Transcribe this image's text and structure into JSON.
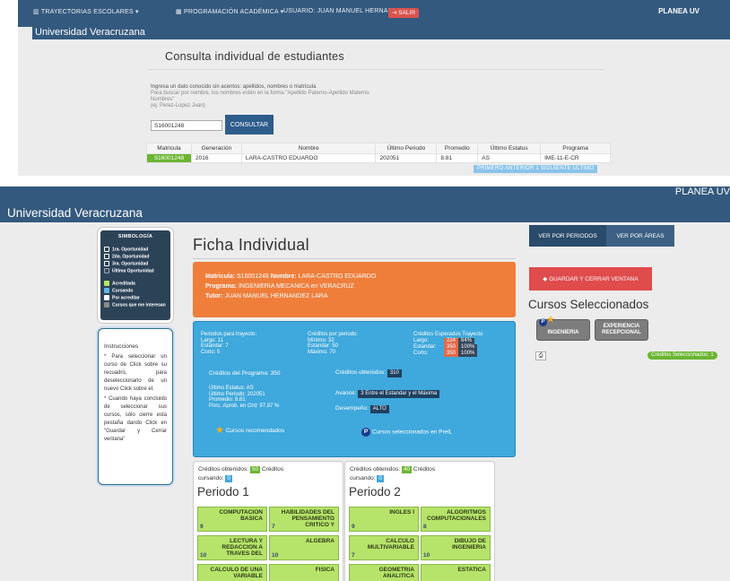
{
  "top": {
    "nav": {
      "trayectorias": "TRAYECTORIAS ESCOLARES",
      "programacion": "PROGRAMACIÓN ACADÉMICA",
      "usuario": "USUARIO: JUAN MANUEL HERNANDEZ",
      "salir": "SALIR",
      "brand": "PLANEA UV"
    },
    "univ": "Universidad Veracruzana",
    "heading": "Consulta individual de estudiantes",
    "help": [
      "Ingresa un dato conocido sin acentos: apellidos, nombres o matrícula",
      "Para buscar por nombre, los nombres estén en la forma \"Apellido Paterno-Apellido Materno Nombres\"",
      "(ej. Perez-Lopez Juan)"
    ],
    "search": {
      "value": "S16001248",
      "button": "CONSULTAR"
    },
    "table": {
      "headers": [
        "Matricula",
        "Generación",
        "Nombre",
        "Último Periodo",
        "Promedio",
        "Último Estatus",
        "Programa"
      ],
      "row": [
        "S16001248",
        "2016",
        "LARA-CASTRO EDUARDO",
        "202051",
        "8.81",
        "AS",
        "IME-11-E-CR"
      ]
    },
    "pager": "PRIMERO  ANTERIOR  1  SIGUIENTE  ÚLTIMO"
  },
  "bottom": {
    "brand": "PLANEA UV",
    "univ": "Universidad Veracruzana",
    "legend": {
      "title": "SIMBOLOGÍA",
      "items": [
        {
          "label": "1ra. Oportunidad",
          "color": "#2c4257",
          "border": "#ffffff"
        },
        {
          "label": "2da. Oportunidad",
          "color": "#2c4257",
          "border": "#ffffff"
        },
        {
          "label": "3ra. Oportunidad",
          "color": "#2c4257",
          "border": "#ffffff"
        },
        {
          "label": "Última Oportunidad",
          "color": "#3a4a5a",
          "border": "#9aa7b4"
        },
        {
          "label": "Acreditada",
          "color": "#b6e36a",
          "border": "#b6e36a"
        },
        {
          "label": "Cursando",
          "color": "#5db6e6",
          "border": "#5db6e6"
        },
        {
          "label": "Por acreditar",
          "color": "#ffffff",
          "border": "#ffffff"
        },
        {
          "label": "Cursos que me interesan",
          "color": "#8a8a8a",
          "border": "#8a8a8a"
        }
      ]
    },
    "instructions": {
      "title": "Instrucciones",
      "p1": "* Para seleccionar un curso de Click sobre su recuadro, para deseleccionarlo de un nuevo Click sobre el.",
      "p2": "* Cuando haya concluido de seleccionar sus cursos, sólo cierre esta pestaña dando Click en \"Guardar y Cerrar ventana\""
    },
    "ficha": {
      "title": "Ficha Individual",
      "matricula_label": "Matricula:",
      "matricula": "S16001248",
      "nombre_label": "Nombre:",
      "nombre": "LARA-CASTRO EDUARDO",
      "programa_label": "Programa:",
      "programa": "INGENIERIA MECANICA en VERACRUZ",
      "tutor_label": "Tutor:",
      "tutor": "JUAN MANUEL HERNANDEZ LARA"
    },
    "summary": {
      "col1": [
        "Periodos para trayecto:",
        "Largo:     11",
        "Estandar:  7",
        "Corto:      5"
      ],
      "col2": [
        "Créditos por periodo:",
        "Mínimo:   32",
        "Estandar: 50",
        "Máximo:   70"
      ],
      "col3_title": "Créditos Esperados Trayecto",
      "col3": [
        {
          "label": "Largo:",
          "value": "224",
          "pct": "64%"
        },
        {
          "label": "Estandar:",
          "value": "350",
          "pct": "100%"
        },
        {
          "label": "Corto:",
          "value": "350",
          "pct": "100%"
        }
      ],
      "programa_creditos": "Créditos del Programa: 350",
      "obtenidos_label": "Créditos obtenidos:",
      "obtenidos": "310",
      "estatus": [
        "Último Estatus: AS",
        "Último Periodo: 202051",
        "Promedio: 8.81",
        "Porc. Aprob. en Ord: 97.87 %"
      ],
      "avance_label": "Avance:",
      "avance": "3 Entre el Estandar y el Máxima",
      "desempeno_label": "Desempeño:",
      "desempeno": "ALTO",
      "recomendados": "Cursos recomendados",
      "seleccionados": "Cursos seleccionados en PrelL"
    },
    "periods": [
      {
        "name": "Periodo 1",
        "cred_label": "Créditos obtenidos:",
        "cred": "50",
        "cred_label2": "Créditos",
        "cursando_label": "cursando:",
        "cursando": "0",
        "courses": [
          {
            "name": "COMPUTACION BASICA",
            "cr": "9"
          },
          {
            "name": "HABILIDADES DEL PENSAMIENTO CRITICO Y",
            "cr": "7"
          },
          {
            "name": "LECTURA Y REDACCION A TRAVES DEL",
            "cr": "10"
          },
          {
            "name": "ALGEBRA",
            "cr": "10"
          },
          {
            "name": "CALCULO DE UNA VARIABLE",
            "cr": "10"
          },
          {
            "name": "FISICA",
            "cr": "9"
          }
        ]
      },
      {
        "name": "Periodo 2",
        "cred_label": "Créditos obtenidos:",
        "cred": "40",
        "cred_label2": "Créditos",
        "cursando_label": "cursando:",
        "cursando": "0",
        "courses": [
          {
            "name": "INGLES I",
            "cr": "9"
          },
          {
            "name": "ALGORITMOS COMPUTACIONALES",
            "cr": "8"
          },
          {
            "name": "CALCULO MULTIVARIABLE",
            "cr": "7"
          },
          {
            "name": "DIBUJO DE INGENIERIA",
            "cr": "10"
          },
          {
            "name": "GEOMETRIA ANALITICA",
            "cr": "8"
          },
          {
            "name": "ESTATICA",
            "cr": "6"
          }
        ]
      }
    ],
    "right": {
      "ver_periodos": "VER POR PERIODOS",
      "ver_areas": "VER POR ÁREAS",
      "save": "GUARDAR Y CERRAR VENTANA",
      "cursos_title": "Cursos Seleccionados",
      "tile1": "INGENIERIA",
      "tile2": "EXPERIENCIA RECEPCIONAL",
      "badge": "Créditos Seleccionados: 1"
    }
  }
}
